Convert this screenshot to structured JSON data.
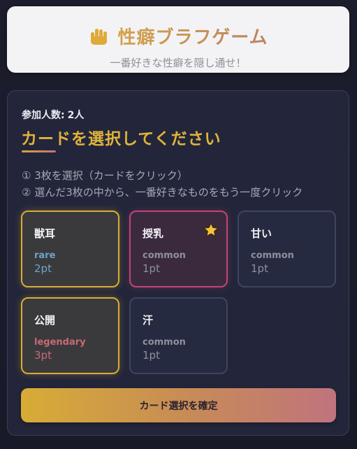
{
  "header": {
    "title": "性癖ブラフゲーム",
    "subtitle": "一番好きな性癖を隠し通せ！",
    "icon": "hand-icon"
  },
  "panel": {
    "players_label": "参加人数:",
    "players_count": "2人",
    "heading": "カードを選択してください",
    "instructions": [
      "① 3枚を選択（カードをクリック）",
      "② 選んだ3枚の中から、一番好きなものをもう一度クリック"
    ],
    "cards": [
      {
        "name": "獣耳",
        "rarity": "rare",
        "points": "2pt",
        "state": "selected"
      },
      {
        "name": "授乳",
        "rarity": "common",
        "points": "1pt",
        "state": "favorite"
      },
      {
        "name": "甘い",
        "rarity": "common",
        "points": "1pt",
        "state": "unselected"
      },
      {
        "name": "公開",
        "rarity": "legendary",
        "points": "3pt",
        "state": "selected"
      },
      {
        "name": "汗",
        "rarity": "common",
        "points": "1pt",
        "state": "unselected"
      }
    ],
    "confirm_label": "カード選択を確定"
  },
  "colors": {
    "accent_gold": "#d9ac36",
    "favorite_pink": "#c24476",
    "rare": "#6ea4c8",
    "legendary": "#c96a74"
  }
}
